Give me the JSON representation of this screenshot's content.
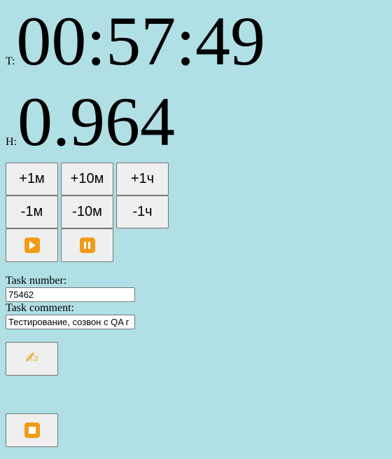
{
  "timer": {
    "prefix": "T:",
    "value": "00:57:49"
  },
  "hours": {
    "prefix": "H:",
    "value": "0.964"
  },
  "adjust_buttons": {
    "plus_1m": "+1м",
    "plus_10m": "+10м",
    "plus_1h": "+1ч",
    "minus_1m": "-1м",
    "minus_10m": "-10м",
    "minus_1h": "-1ч"
  },
  "controls": {
    "play_icon": "play-icon",
    "pause_icon": "pause-icon",
    "write_icon": "writing-hand-icon",
    "stop_icon": "stop-icon"
  },
  "form": {
    "task_number_label": "Task number:",
    "task_number_value": "75462",
    "task_comment_label": "Task comment:",
    "task_comment_value": "Тестирование, созвон с QA г"
  },
  "colors": {
    "background": "#b0dfe5",
    "button_bg": "#efefef",
    "emoji_accent": "#f29a17"
  }
}
